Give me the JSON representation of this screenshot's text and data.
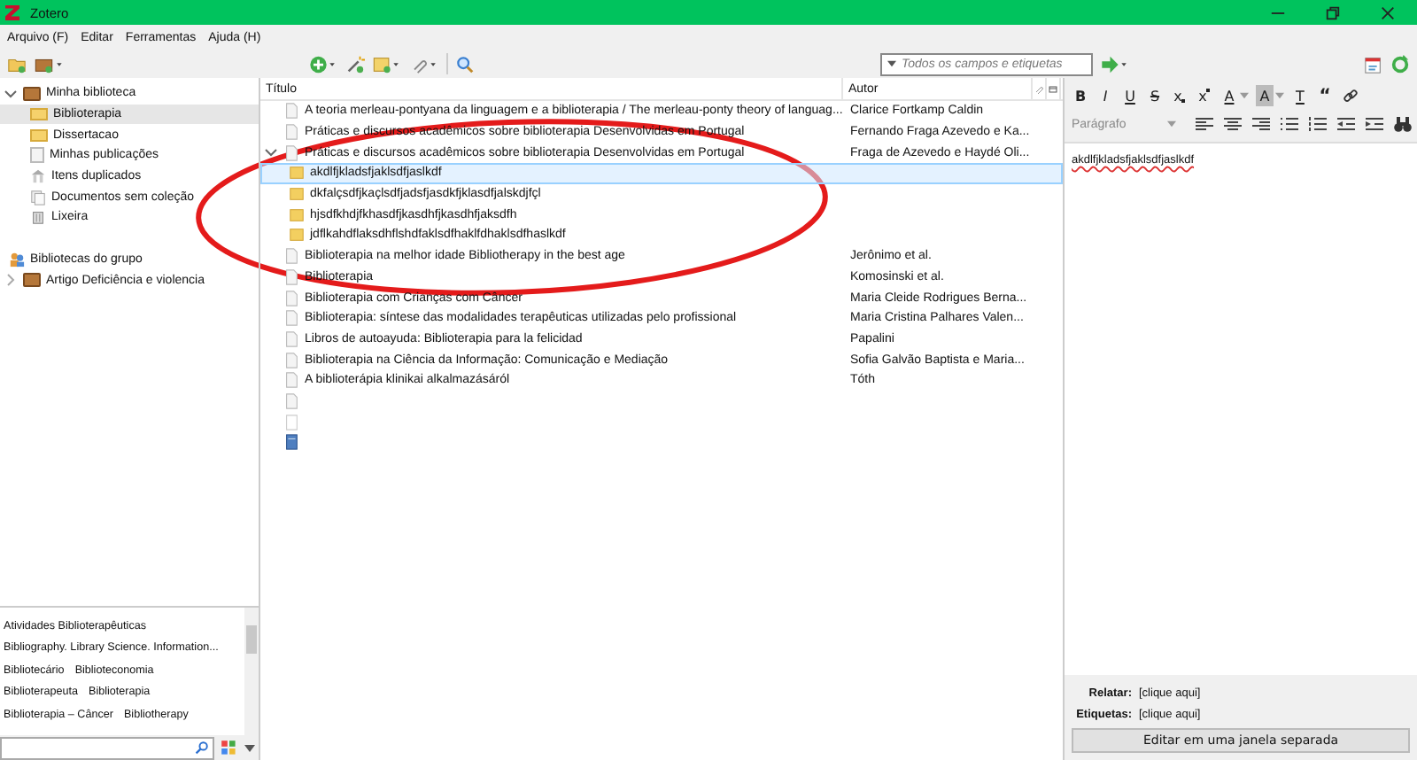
{
  "window": {
    "title": "Zotero"
  },
  "menu": [
    {
      "label": "Arquivo (F)"
    },
    {
      "label": "Editar"
    },
    {
      "label": "Ferramentas"
    },
    {
      "label": "Ajuda (H)"
    }
  ],
  "search": {
    "placeholder": "Todos os campos e etiquetas"
  },
  "collections": [
    {
      "label": "Minha biblioteca",
      "kind": "library",
      "expanded": true,
      "selected": false,
      "children": [
        {
          "label": "Biblioterapia",
          "kind": "folder",
          "selected": true
        },
        {
          "label": "Dissertacao",
          "kind": "folder",
          "selected": false
        },
        {
          "label": "Minhas publicações",
          "kind": "page",
          "selected": false
        },
        {
          "label": "Itens duplicados",
          "kind": "duplicates",
          "selected": false
        },
        {
          "label": "Documentos sem coleção",
          "kind": "unfiled",
          "selected": false
        },
        {
          "label": "Lixeira",
          "kind": "trash",
          "selected": false
        }
      ]
    }
  ],
  "groups": {
    "label": "Bibliotecas do grupo",
    "items": [
      {
        "label": "Artigo Deficiência e violencia",
        "kind": "library",
        "expanded": false,
        "selected": false
      }
    ]
  },
  "tags": [
    [
      "Atividades Biblioterapêuticas"
    ],
    [
      "Bibliography. Library Science. Information..."
    ],
    [
      "Bibliotecário",
      "Biblioteconomia"
    ],
    [
      "Biblioterapeuta",
      "Biblioterapia"
    ],
    [
      "Biblioterapia – Câncer",
      "Bibliotherapy"
    ]
  ],
  "table": {
    "columns": [
      "Título",
      "Autor"
    ],
    "rows": [
      {
        "kind": "document",
        "title": "A teoria merleau-pontyana da linguagem e a biblioterapia / The merleau-ponty theory of languag...",
        "author": "Clarice Fortkamp Caldin",
        "selected": false
      },
      {
        "kind": "document",
        "title": "Práticas e discursos acadêmicos sobre biblioterapia Desenvolvidas em Portugal",
        "author": "Fernando Fraga Azevedo e Ka...",
        "selected": false
      },
      {
        "kind": "document",
        "title": "Práticas e discursos acadêmicos sobre biblioterapia Desenvolvidas em Portugal",
        "author": "Fraga de Azevedo e Haydé Oli...",
        "selected": false,
        "expanded": true,
        "children": [
          {
            "kind": "note",
            "title": "akdlfjkladsfjaklsdfjaslkdf",
            "selected": true
          },
          {
            "kind": "note",
            "title": "dkfalçsdfjkaçlsdfjadsfjasdkfjklasdfjalskdjfçl",
            "selected": false
          },
          {
            "kind": "note",
            "title": "hjsdfkhdjfkhasdfjkasdhfjkasdhfjaksdfh",
            "selected": false
          },
          {
            "kind": "note",
            "title": "jdflkahdflaksdhflshdfaklsdfhaklfdhaklsdfhaslkdf",
            "selected": false
          }
        ]
      },
      {
        "kind": "document",
        "title": "Biblioterapia na melhor idade Bibliotherapy in the best age",
        "author": "Jerônimo et al.",
        "selected": false
      },
      {
        "kind": "document",
        "title": "Biblioterapia",
        "author": "Komosinski et al.",
        "selected": false
      },
      {
        "kind": "document",
        "title": "Biblioterapia com Crianças com Câncer",
        "author": "Maria Cleide Rodrigues Berna...",
        "selected": false
      },
      {
        "kind": "document",
        "title": "Biblioterapia: síntese das modalidades terapêuticas utilizadas pelo profissional",
        "author": "Maria Cristina Palhares Valen...",
        "selected": false
      },
      {
        "kind": "document",
        "title": "Libros de autoayuda: Biblioterapia para la felicidad",
        "author": "Papalini",
        "selected": false
      },
      {
        "kind": "document",
        "title": "Biblioterapia na Ciência da Informação: Comunicação e Mediação",
        "author": "Sofia Galvão Baptista e Maria...",
        "selected": false
      },
      {
        "kind": "document",
        "title": "A biblioterápia klinikai alkalmazásáról",
        "author": "Tóth",
        "selected": false
      },
      {
        "kind": "document",
        "selected": false
      },
      {
        "kind": "blank",
        "selected": false
      },
      {
        "kind": "book",
        "selected": false
      }
    ]
  },
  "editor": {
    "format_buttons": [
      {
        "label": "B",
        "kind": "bold"
      },
      {
        "label": "I",
        "kind": "italic"
      },
      {
        "label": "U",
        "kind": "underline"
      },
      {
        "label": "S",
        "kind": "strike"
      },
      {
        "label": "x",
        "kind": "subscript"
      },
      {
        "label": "x",
        "kind": "superscript"
      },
      {
        "label": "A",
        "kind": "text-color"
      },
      {
        "label": "A",
        "kind": "highlight"
      },
      {
        "label": "T",
        "kind": "clear"
      },
      {
        "label": "“",
        "kind": "quote"
      },
      {
        "kind": "link"
      }
    ],
    "paragraph": "Parágrafo",
    "tools": [
      {
        "kind": "align-left"
      },
      {
        "kind": "align-center"
      },
      {
        "kind": "align-right"
      },
      {
        "kind": "bullets"
      },
      {
        "kind": "numbers"
      },
      {
        "kind": "outdent"
      },
      {
        "kind": "indent"
      },
      {
        "kind": "find"
      }
    ],
    "text": "akdlfjkladsfjaklsdfjaslkdf"
  },
  "related": {
    "label": "Relatar:",
    "value": "[clique aqui]"
  },
  "tags_field": {
    "label": "Etiquetas:",
    "value": "[clique aqui]"
  },
  "separate_button": "Editar em uma janela separada"
}
